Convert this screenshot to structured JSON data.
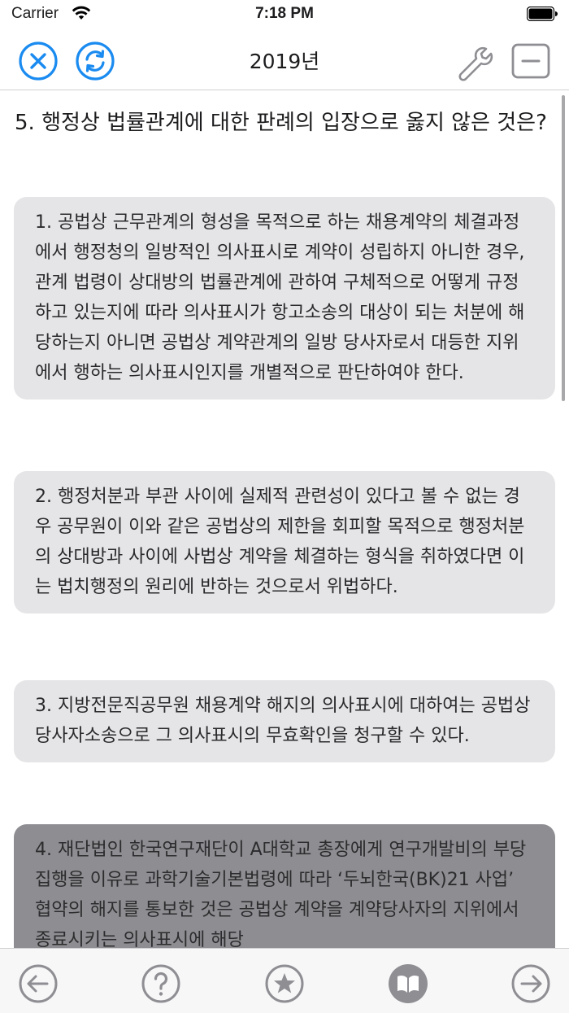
{
  "status_bar": {
    "carrier": "Carrier",
    "time": "7:18 PM"
  },
  "nav": {
    "title": "2019년",
    "left_buttons": [
      "close-icon",
      "refresh-icon"
    ],
    "right_buttons": [
      "wrench-icon",
      "minus-square-icon"
    ]
  },
  "question": "5. 행정상 법률관계에 대한 판례의 입장으로 옳지 않은 것은?",
  "options": [
    {
      "text": "1. 공법상 근무관계의 형성을 목적으로 하는 채용계약의 체결과정에서 행정청의 일방적인 의사표시로 계약이 성립하지 아니한 경우, 관계 법령이 상대방의 법률관계에 관하여 구체적으로 어떻게 규정하고 있는지에 따라 의사표시가 항고소송의 대상이 되는 처분에 해당하는지 아니면 공법상 계약관계의 일방 당사자로서 대등한 지위에서 행하는 의사표시인지를 개별적으로 판단하여야 한다."
    },
    {
      "text": "2. 행정처분과 부관 사이에 실제적 관련성이 있다고 볼 수 없는 경우 공무원이 이와 같은 공법상의 제한을 회피할 목적으로 행정처분의 상대방과 사이에 사법상 계약을 체결하는 형식을 취하였다면 이는 법치행정의 원리에 반하는 것으로서 위법하다."
    },
    {
      "text": "3. 지방전문직공무원 채용계약 해지의 의사표시에 대하여는 공법상 당사자소송으로 그 의사표시의 무효확인을 청구할 수 있다."
    },
    {
      "text": "4. 재단법인 한국연구재단이 A대학교 총장에게 연구개발비의 부당집행을 이유로 과학기술기본법령에 따라 ‘두뇌한국(BK)21 사업’ 협약의 해지를 통보한 것은 공법상 계약을 계약당사자의 지위에서 종료시키는 의사표시에 해당",
      "selected": true
    }
  ],
  "toolbar": [
    "back-arrow-icon",
    "help-icon",
    "star-icon",
    "book-icon",
    "forward-arrow-icon"
  ],
  "colors": {
    "accent": "#1a8bf0",
    "icon_gray": "#8e8e93",
    "option_bg": "#e5e5e7",
    "option_selected_bg": "#8e8e92"
  }
}
